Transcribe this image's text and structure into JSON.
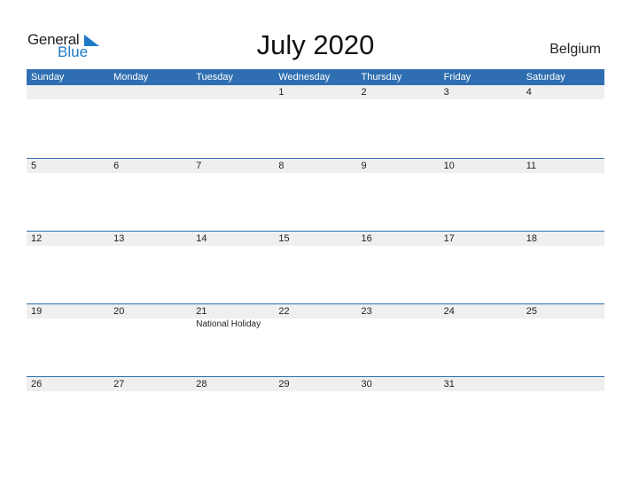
{
  "logo": {
    "word1": "General",
    "word2": "Blue"
  },
  "title": "July 2020",
  "country": "Belgium",
  "weekdays": [
    "Sunday",
    "Monday",
    "Tuesday",
    "Wednesday",
    "Thursday",
    "Friday",
    "Saturday"
  ],
  "weeks": [
    {
      "days": [
        "",
        "",
        "",
        "1",
        "2",
        "3",
        "4"
      ],
      "events": [
        "",
        "",
        "",
        "",
        "",
        "",
        ""
      ]
    },
    {
      "days": [
        "5",
        "6",
        "7",
        "8",
        "9",
        "10",
        "11"
      ],
      "events": [
        "",
        "",
        "",
        "",
        "",
        "",
        ""
      ]
    },
    {
      "days": [
        "12",
        "13",
        "14",
        "15",
        "16",
        "17",
        "18"
      ],
      "events": [
        "",
        "",
        "",
        "",
        "",
        "",
        ""
      ]
    },
    {
      "days": [
        "19",
        "20",
        "21",
        "22",
        "23",
        "24",
        "25"
      ],
      "events": [
        "",
        "",
        "National Holiday",
        "",
        "",
        "",
        ""
      ]
    },
    {
      "days": [
        "26",
        "27",
        "28",
        "29",
        "30",
        "31",
        ""
      ],
      "events": [
        "",
        "",
        "",
        "",
        "",
        "",
        ""
      ]
    }
  ],
  "colors": {
    "accent": "#2f6fb1",
    "date_strip": "#efefef",
    "logo_blue": "#1f7ac8"
  }
}
